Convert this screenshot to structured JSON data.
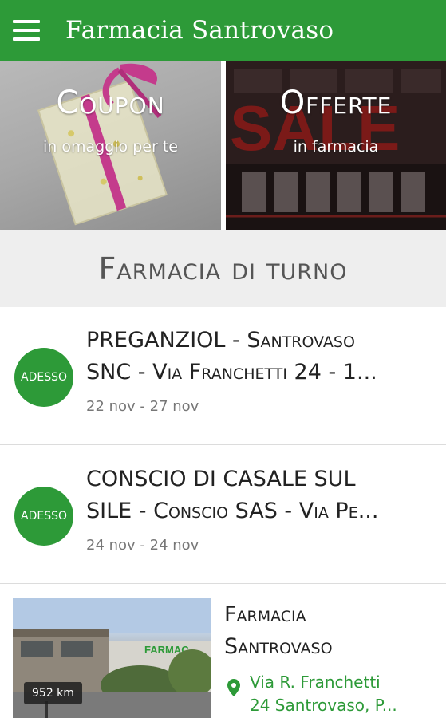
{
  "app_bar": {
    "title": "Farmacia Santrovaso",
    "menu_icon": "hamburger-menu-icon"
  },
  "banners": [
    {
      "title": "Coupon",
      "subtitle": "in omaggio per te"
    },
    {
      "title": "Offerte",
      "subtitle": "in farmacia"
    }
  ],
  "section": {
    "title": "Farmacia di turno"
  },
  "turni": [
    {
      "badge": "ADESSO",
      "name_line1": "PREGANZIOL - Santrovaso",
      "name_line2": "SNC - Via Franchetti 24 - 1...",
      "dates": "22 nov - 27 nov"
    },
    {
      "badge": "ADESSO",
      "name_line1": "CONSCIO DI CASALE SUL",
      "name_line2": "SILE - Conscio SAS - Via Pe...",
      "dates": "24 nov - 24 nov"
    }
  ],
  "pharmacy": {
    "name_line1": "Farmacia",
    "name_line2": "Santrovaso",
    "distance": "952 km",
    "address_line1": "Via R. Franchetti",
    "address_line2": "24 Santrovaso, P...",
    "photo_sign": "FARMAC",
    "pin_icon": "location-pin-icon"
  },
  "colors": {
    "brand_green": "#2d9a38",
    "header_bg": "#eeeeee",
    "offerte_sign": "#c0201c"
  }
}
